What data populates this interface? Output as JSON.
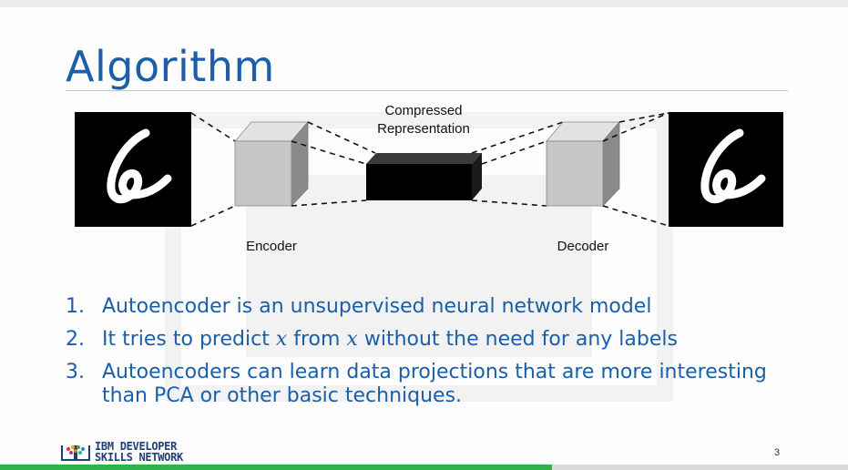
{
  "slide": {
    "title": "Algorithm",
    "page_number": "3"
  },
  "diagram": {
    "compressed_label_line1": "Compressed",
    "compressed_label_line2": "Representation",
    "encoder_label": "Encoder",
    "decoder_label": "Decoder",
    "input_digit": "6",
    "output_digit": "6"
  },
  "bullets": [
    {
      "num": "1.",
      "text": "Autoencoder is an unsupervised neural network model"
    },
    {
      "num": "2.",
      "pre": "It tries to predict ",
      "var1": "x",
      "mid": " from ",
      "var2": "x",
      "post": " without the need for any labels"
    },
    {
      "num": "3.",
      "line1": "Autoencoders can learn data projections that are more interesting",
      "line2": "than PCA or other basic techniques."
    }
  ],
  "footer": {
    "logo_line1": "IBM DEVELOPER",
    "logo_line2": "SKILLS NETWORK"
  }
}
